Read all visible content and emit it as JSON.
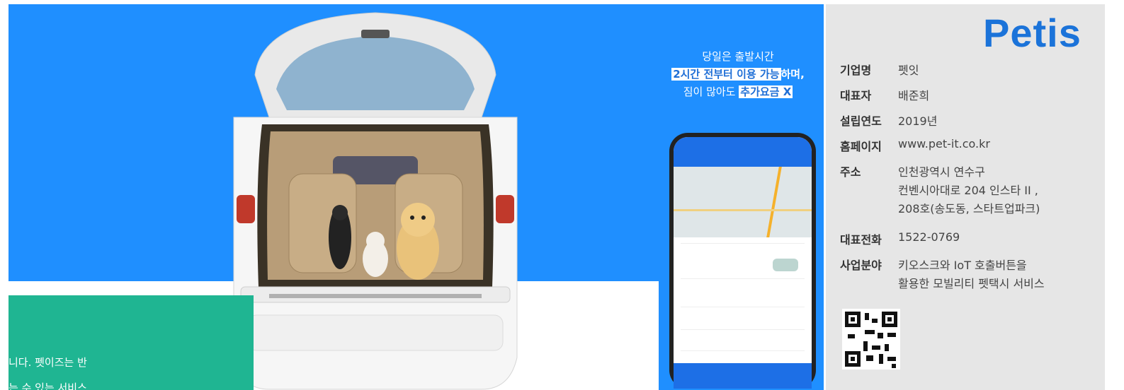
{
  "banner": {
    "promo": {
      "line1": "당일은 출발시간",
      "line2_hl": "2시간 전부터 이용 가능",
      "line2_rest": "하며,",
      "line3_plain": "짐이 많아도 ",
      "line3_hl": "추가요금 X"
    },
    "green_card": {
      "text1": "니다. 펫이즈는 반",
      "text2": "는 수 있는 서비스"
    }
  },
  "panel": {
    "logo": "Petis",
    "company_label": "기업명",
    "company_value": "펫잇",
    "ceo_label": "대표자",
    "ceo_value": "배준희",
    "year_label": "설립연도",
    "year_value": "2019년",
    "homepage_label": "홈페이지",
    "homepage_value": "www.pet-it.co.kr",
    "address_label": "주소",
    "address_line1": "인천광역시 연수구",
    "address_line2": "컨벤시아대로 204 인스타 II ,",
    "address_line3": "208호(송도동, 스타트업파크)",
    "phone_label": "대표전화",
    "phone_value": "1522-0769",
    "business_label": "사업분야",
    "business_line1": "키오스크와 IoT 호출버튼을",
    "business_line2": "활용한 모빌리티 펫택시 서비스"
  },
  "colors": {
    "banner_blue": "#1f8fff",
    "green": "#1fb592",
    "logo_blue": "#1b73d9",
    "panel_gray": "#e6e6e6"
  }
}
